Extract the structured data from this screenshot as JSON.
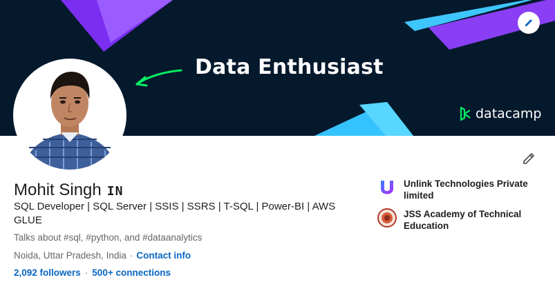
{
  "banner": {
    "headline": "Data Enthusiast",
    "brand": "datacamp",
    "edit_icon": "pencil-icon",
    "colors": {
      "background": "#05192d",
      "purple": "#7933ff",
      "cyan": "#03ef62",
      "blue": "#4ac0ff"
    }
  },
  "profile": {
    "name": "Mohit Singh",
    "pronoun_badge": "IN",
    "headline": "SQL Developer | SQL Server | SSIS | SSRS | T-SQL | Power-BI | AWS GLUE",
    "talks_about": "Talks about #sql, #python, and #dataanalytics",
    "location": "Noida, Uttar Pradesh, India",
    "contact_link": "Contact info",
    "followers": "2,092 followers",
    "separator": "·",
    "connections": "500+ connections",
    "edit_icon": "pencil-icon"
  },
  "experience": [
    {
      "label": "Unlink Technologies Private limited",
      "icon": "company-logo"
    },
    {
      "label": "JSS Academy of Technical Education",
      "icon": "school-logo"
    }
  ]
}
